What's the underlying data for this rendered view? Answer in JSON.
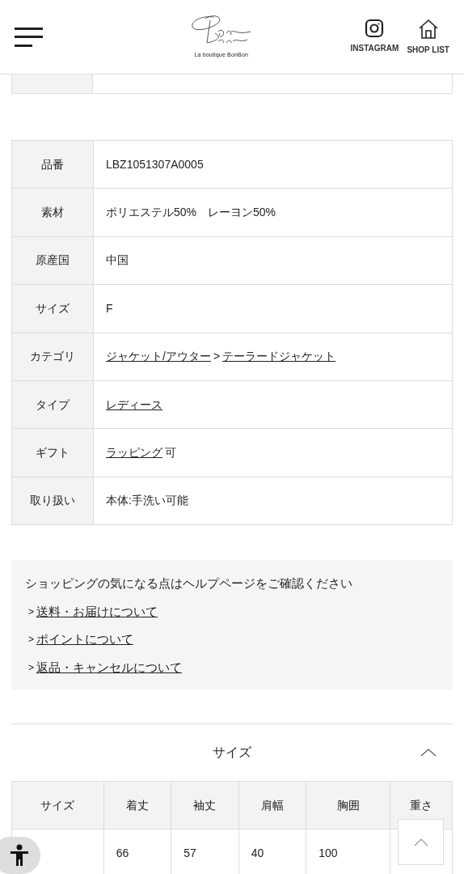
{
  "header": {
    "logo_caption": "La boutique BonBon",
    "actions": [
      {
        "kind": "instagram",
        "label": "INSTAGRAM"
      },
      {
        "kind": "shop",
        "label": "SHOP LIST"
      }
    ]
  },
  "spec_table": [
    {
      "label": "品番",
      "value": [
        {
          "text": "LBZ1051307A0005",
          "link": false
        }
      ]
    },
    {
      "label": "素材",
      "value": [
        {
          "text": "ポリエステル50%　レーヨン50%",
          "link": false
        }
      ]
    },
    {
      "label": "原産国",
      "value": [
        {
          "text": "中国",
          "link": false
        }
      ]
    },
    {
      "label": "サイズ",
      "value": [
        {
          "text": "F",
          "link": false
        }
      ]
    },
    {
      "label": "カテゴリ",
      "value": [
        {
          "text": "ジャケット/アウター",
          "link": true
        },
        {
          "text": ">",
          "link": false
        },
        {
          "text": "テーラードジャケット",
          "link": true
        }
      ]
    },
    {
      "label": "タイプ",
      "value": [
        {
          "text": "レディース",
          "link": true
        }
      ]
    },
    {
      "label": "ギフト",
      "value": [
        {
          "text": "ラッピング",
          "link": true
        },
        {
          "text": "可",
          "link": false
        }
      ]
    },
    {
      "label": "取り扱い",
      "value": [
        {
          "text": "本体:手洗い可能",
          "link": false
        }
      ]
    }
  ],
  "help": {
    "title": "ショッピングの気になる点はヘルプページをご確認ください",
    "links": [
      {
        "marker": ">",
        "label": "送料・お届けについて"
      },
      {
        "marker": ">",
        "label": "ポイントについて"
      },
      {
        "marker": ">",
        "label": "返品・キャンセルについて"
      }
    ]
  },
  "size_section": {
    "title": "サイズ",
    "expanded": true,
    "columns": [
      "サイズ",
      "着丈",
      "袖丈",
      "肩幅",
      "胸囲",
      "重さ"
    ],
    "rows": [
      [
        "",
        "66",
        "57",
        "40",
        "100",
        ""
      ]
    ]
  }
}
